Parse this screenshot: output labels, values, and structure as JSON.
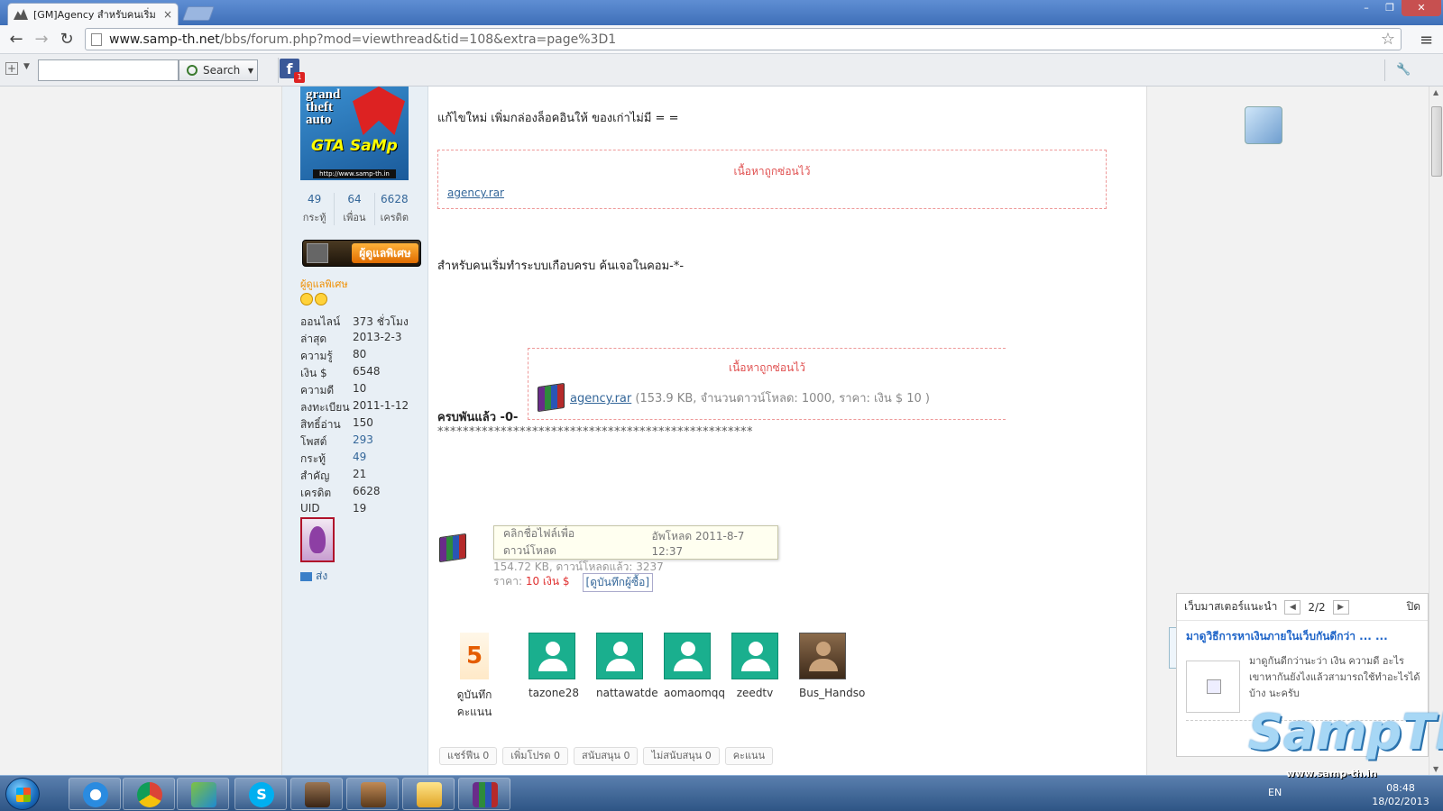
{
  "browser": {
    "tab_title": "[GM]Agency สำหรับคนเริ่ม",
    "tab_close": "×",
    "window_controls": {
      "min": "–",
      "max": "❐",
      "close": "✕"
    },
    "url_domain": "www.samp-th.net",
    "url_path": "/bbs/forum.php?mod=viewthread&tid=108&extra=page%3D1",
    "nav": {
      "back": "←",
      "forward": "→",
      "reload": "↻",
      "star": "☆",
      "menu": "≡"
    }
  },
  "extbar": {
    "search_placeholder": "",
    "search_label": "Search",
    "fb_badge": "1",
    "wrench": "🔧"
  },
  "sidebar": {
    "stats": [
      {
        "num": "49",
        "label": "กระทู้"
      },
      {
        "num": "64",
        "label": "เพื่อน"
      },
      {
        "num": "6628",
        "label": "เครดิต"
      }
    ],
    "rank_label": "ผู้ดูแลพิเศษ",
    "rank_name": "ผู้ดูแลพิเศษ",
    "profile": [
      {
        "k": "ออนไลน์",
        "v": "373 ชั่วโมง",
        "link": false
      },
      {
        "k": "ล่าสุด",
        "v": "2013-2-3",
        "link": false
      },
      {
        "k": "ความรู้",
        "v": "80",
        "link": false
      },
      {
        "k": "เงิน $",
        "v": "6548",
        "link": false
      },
      {
        "k": "ความดี",
        "v": "10",
        "link": false
      },
      {
        "k": "ลงทะเบียน",
        "v": "2011-1-12",
        "link": false
      },
      {
        "k": "สิทธิ์อ่าน",
        "v": "150",
        "link": false
      },
      {
        "k": "โพสต์",
        "v": "293",
        "link": true
      },
      {
        "k": "กระทู้",
        "v": "49",
        "link": true
      },
      {
        "k": "สำคัญ",
        "v": "21",
        "link": false
      },
      {
        "k": "เครดิต",
        "v": "6628",
        "link": false
      },
      {
        "k": "UID",
        "v": "19",
        "link": false
      }
    ],
    "send_label": "ส่ง"
  },
  "post": {
    "line1": "แก้ไขใหม่ เพิ่มกล่องล็อคอินให้ ของเก่าไม่มี = =",
    "hidden_title_1": "เนื้อหาถูกซ่อนไว้",
    "attach_1": "agency.rar",
    "line2": "สำหรับคนเริ่มทำระบบเกือบครบ ค้นเจอในคอม-*-",
    "hidden_title_2": "เนื้อหาถูกซ่อนไว้",
    "attach_2": "agency.rar",
    "attach_2_meta": "(153.9 KB, จำนวนดาวน์โหลด: 1000, ราคา: เงิน $ 10 )",
    "line3": "ครบพันแล้ว -0-",
    "stars": "**************************************************",
    "tooltip_left": "คลิกชื่อไฟล์เพื่อดาวน์โหลด",
    "tooltip_right": "อัพโหลด 2011-8-7 12:37",
    "dl_meta": "154.72 KB, ดาวน์โหลดแล้ว: 3237",
    "price_label": "ราคา:",
    "price_value": "10 เงิน $",
    "buyers_link": "[ดูบันทึกผู้ซื้อ]"
  },
  "rating": {
    "score": "5",
    "score_label": "ดูบันทึกคะแนน",
    "users": [
      "tazone28",
      "nattawatde",
      "aomaomqq",
      "zeedtv",
      "Bus_Handso"
    ]
  },
  "actions": [
    "แชร์ฟีน 0",
    "เพิ่มโปรด 0",
    "สนับสนุน 0",
    "ไม่สนับสนุน 0",
    "คะแนน"
  ],
  "float_panel": {
    "heading": "เว็บมาสเตอร์แนะนำ",
    "page": "2/2",
    "close": "ปิด",
    "title": "มาดูวิธีการหาเงินภายในเว็บกันดีกว่า ... ...",
    "desc": "มาดูกันดีกว่านะว่า เงิน ความดี อะไร เขาหากันยังไงแล้วสามารถใช้ทำอะไรได้บ้าง นะครับ"
  },
  "logo": {
    "text": "SampTh",
    "url": "www.samp-th.in"
  },
  "taskbar": {
    "lang": "EN",
    "time": "08:48",
    "date": "18/02/2013"
  }
}
